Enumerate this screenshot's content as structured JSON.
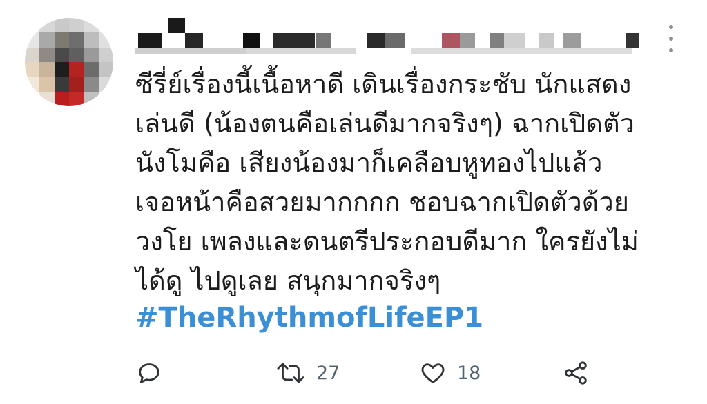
{
  "tweet": {
    "body_lines": [
      "ซีรี่ย์เรื่องนี้เนื้อหาดี เดินเรื่องกระชับ นักแสดง",
      "เล่นดี (น้องตนคือเล่นดีมากจริงๆ) ฉากเปิดตัว",
      "นังโมคือ เสียงน้องมาก็เคลือบหูทองไปแล้ว",
      "เจอหน้าคือสวยมากกกก ชอบฉากเปิดตัวด้วย",
      "วงโย เพลงและดนตรีประกอบดีมาก ใครยังไม่",
      "ได้ดู ไปดูเลย สนุกมากจริงๆ"
    ],
    "hashtag": "#TheRhythmofLifeEP1",
    "retweet_count": "27",
    "like_count": "18",
    "hashtag_color": "#3b8fd6",
    "icons": [
      "more-icon",
      "reply-icon",
      "retweet-icon",
      "like-icon",
      "share-icon"
    ]
  }
}
